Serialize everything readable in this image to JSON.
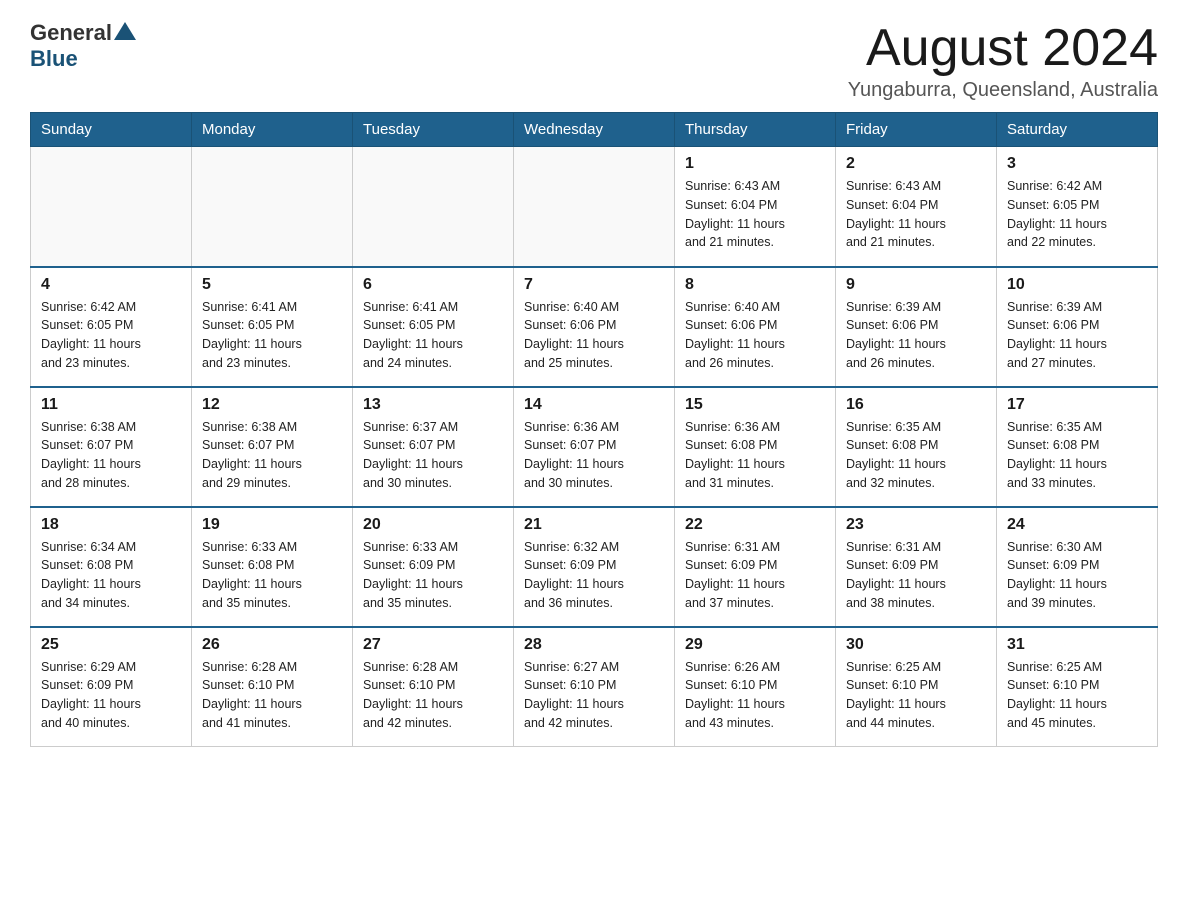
{
  "header": {
    "logo_general": "General",
    "logo_blue": "Blue",
    "title": "August 2024",
    "location": "Yungaburra, Queensland, Australia"
  },
  "weekdays": [
    "Sunday",
    "Monday",
    "Tuesday",
    "Wednesday",
    "Thursday",
    "Friday",
    "Saturday"
  ],
  "weeks": [
    [
      {
        "day": "",
        "info": ""
      },
      {
        "day": "",
        "info": ""
      },
      {
        "day": "",
        "info": ""
      },
      {
        "day": "",
        "info": ""
      },
      {
        "day": "1",
        "info": "Sunrise: 6:43 AM\nSunset: 6:04 PM\nDaylight: 11 hours\nand 21 minutes."
      },
      {
        "day": "2",
        "info": "Sunrise: 6:43 AM\nSunset: 6:04 PM\nDaylight: 11 hours\nand 21 minutes."
      },
      {
        "day": "3",
        "info": "Sunrise: 6:42 AM\nSunset: 6:05 PM\nDaylight: 11 hours\nand 22 minutes."
      }
    ],
    [
      {
        "day": "4",
        "info": "Sunrise: 6:42 AM\nSunset: 6:05 PM\nDaylight: 11 hours\nand 23 minutes."
      },
      {
        "day": "5",
        "info": "Sunrise: 6:41 AM\nSunset: 6:05 PM\nDaylight: 11 hours\nand 23 minutes."
      },
      {
        "day": "6",
        "info": "Sunrise: 6:41 AM\nSunset: 6:05 PM\nDaylight: 11 hours\nand 24 minutes."
      },
      {
        "day": "7",
        "info": "Sunrise: 6:40 AM\nSunset: 6:06 PM\nDaylight: 11 hours\nand 25 minutes."
      },
      {
        "day": "8",
        "info": "Sunrise: 6:40 AM\nSunset: 6:06 PM\nDaylight: 11 hours\nand 26 minutes."
      },
      {
        "day": "9",
        "info": "Sunrise: 6:39 AM\nSunset: 6:06 PM\nDaylight: 11 hours\nand 26 minutes."
      },
      {
        "day": "10",
        "info": "Sunrise: 6:39 AM\nSunset: 6:06 PM\nDaylight: 11 hours\nand 27 minutes."
      }
    ],
    [
      {
        "day": "11",
        "info": "Sunrise: 6:38 AM\nSunset: 6:07 PM\nDaylight: 11 hours\nand 28 minutes."
      },
      {
        "day": "12",
        "info": "Sunrise: 6:38 AM\nSunset: 6:07 PM\nDaylight: 11 hours\nand 29 minutes."
      },
      {
        "day": "13",
        "info": "Sunrise: 6:37 AM\nSunset: 6:07 PM\nDaylight: 11 hours\nand 30 minutes."
      },
      {
        "day": "14",
        "info": "Sunrise: 6:36 AM\nSunset: 6:07 PM\nDaylight: 11 hours\nand 30 minutes."
      },
      {
        "day": "15",
        "info": "Sunrise: 6:36 AM\nSunset: 6:08 PM\nDaylight: 11 hours\nand 31 minutes."
      },
      {
        "day": "16",
        "info": "Sunrise: 6:35 AM\nSunset: 6:08 PM\nDaylight: 11 hours\nand 32 minutes."
      },
      {
        "day": "17",
        "info": "Sunrise: 6:35 AM\nSunset: 6:08 PM\nDaylight: 11 hours\nand 33 minutes."
      }
    ],
    [
      {
        "day": "18",
        "info": "Sunrise: 6:34 AM\nSunset: 6:08 PM\nDaylight: 11 hours\nand 34 minutes."
      },
      {
        "day": "19",
        "info": "Sunrise: 6:33 AM\nSunset: 6:08 PM\nDaylight: 11 hours\nand 35 minutes."
      },
      {
        "day": "20",
        "info": "Sunrise: 6:33 AM\nSunset: 6:09 PM\nDaylight: 11 hours\nand 35 minutes."
      },
      {
        "day": "21",
        "info": "Sunrise: 6:32 AM\nSunset: 6:09 PM\nDaylight: 11 hours\nand 36 minutes."
      },
      {
        "day": "22",
        "info": "Sunrise: 6:31 AM\nSunset: 6:09 PM\nDaylight: 11 hours\nand 37 minutes."
      },
      {
        "day": "23",
        "info": "Sunrise: 6:31 AM\nSunset: 6:09 PM\nDaylight: 11 hours\nand 38 minutes."
      },
      {
        "day": "24",
        "info": "Sunrise: 6:30 AM\nSunset: 6:09 PM\nDaylight: 11 hours\nand 39 minutes."
      }
    ],
    [
      {
        "day": "25",
        "info": "Sunrise: 6:29 AM\nSunset: 6:09 PM\nDaylight: 11 hours\nand 40 minutes."
      },
      {
        "day": "26",
        "info": "Sunrise: 6:28 AM\nSunset: 6:10 PM\nDaylight: 11 hours\nand 41 minutes."
      },
      {
        "day": "27",
        "info": "Sunrise: 6:28 AM\nSunset: 6:10 PM\nDaylight: 11 hours\nand 42 minutes."
      },
      {
        "day": "28",
        "info": "Sunrise: 6:27 AM\nSunset: 6:10 PM\nDaylight: 11 hours\nand 42 minutes."
      },
      {
        "day": "29",
        "info": "Sunrise: 6:26 AM\nSunset: 6:10 PM\nDaylight: 11 hours\nand 43 minutes."
      },
      {
        "day": "30",
        "info": "Sunrise: 6:25 AM\nSunset: 6:10 PM\nDaylight: 11 hours\nand 44 minutes."
      },
      {
        "day": "31",
        "info": "Sunrise: 6:25 AM\nSunset: 6:10 PM\nDaylight: 11 hours\nand 45 minutes."
      }
    ]
  ]
}
